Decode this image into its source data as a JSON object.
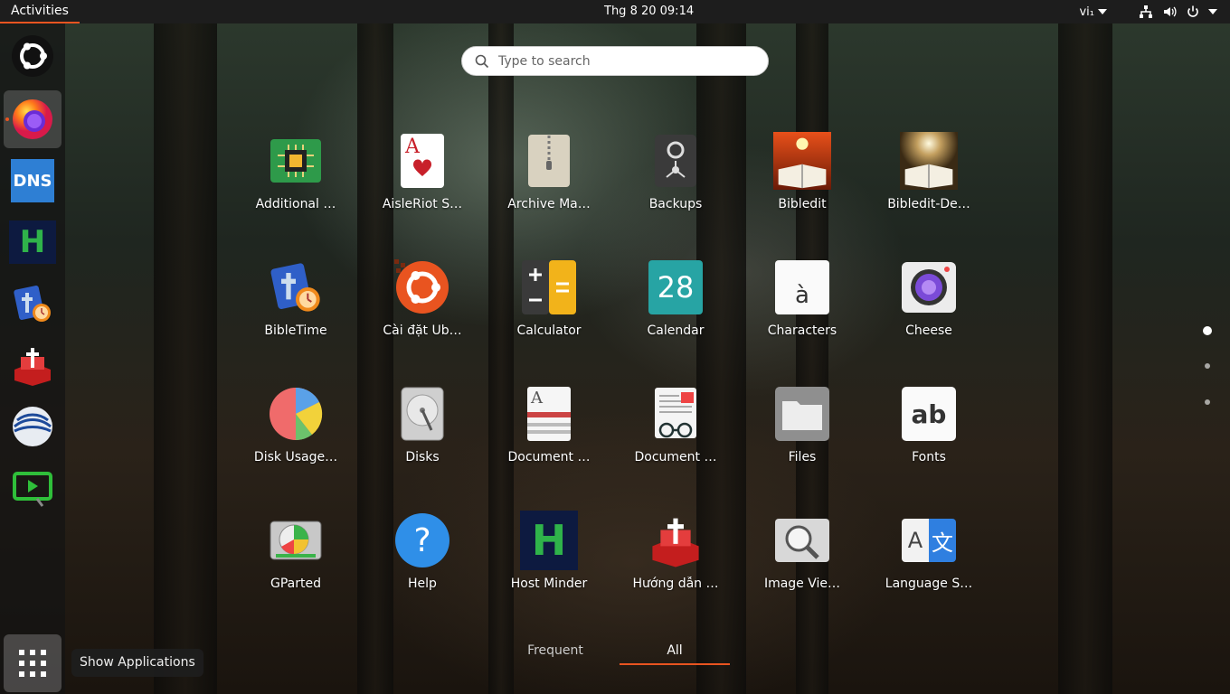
{
  "topbar": {
    "activities": "Activities",
    "clock": "Thg 8 20  09:14",
    "language": "vi₁"
  },
  "dock": {
    "items": [
      {
        "name": "ubuntu-logo-icon"
      },
      {
        "name": "firefox-icon"
      },
      {
        "name": "dns-icon",
        "text": "DNS"
      },
      {
        "name": "host-minder-icon",
        "text": "H"
      },
      {
        "name": "bibletime-icon"
      },
      {
        "name": "huong-dan-icon"
      },
      {
        "name": "unknown-globe-icon"
      },
      {
        "name": "screen-cast-icon"
      }
    ],
    "tooltip": "Show Applications"
  },
  "search": {
    "placeholder": "Type to search"
  },
  "apps": [
    {
      "label": "Additional …",
      "icon": "chip-icon"
    },
    {
      "label": "AisleRiot S…",
      "icon": "playing-card-icon",
      "text": "A"
    },
    {
      "label": "Archive Ma…",
      "icon": "archive-icon"
    },
    {
      "label": "Backups",
      "icon": "backups-icon"
    },
    {
      "label": "Bibledit",
      "icon": "bible-icon"
    },
    {
      "label": "Bibledit-De…",
      "icon": "bible-icon"
    },
    {
      "label": "BibleTime",
      "icon": "bibletime-icon"
    },
    {
      "label": "Cài đặt Ub…",
      "icon": "ubuntu-install-icon"
    },
    {
      "label": "Calculator",
      "icon": "calculator-icon"
    },
    {
      "label": "Calendar",
      "icon": "calendar-icon",
      "text": "28"
    },
    {
      "label": "Characters",
      "icon": "characters-icon",
      "text": "à"
    },
    {
      "label": "Cheese",
      "icon": "camera-icon"
    },
    {
      "label": "Disk Usage…",
      "icon": "pie-icon"
    },
    {
      "label": "Disks",
      "icon": "disk-icon"
    },
    {
      "label": "Document …",
      "icon": "document-icon",
      "text": "A"
    },
    {
      "label": "Document …",
      "icon": "document-scanner-icon"
    },
    {
      "label": "Files",
      "icon": "folder-icon"
    },
    {
      "label": "Fonts",
      "icon": "fonts-icon",
      "text": "ab"
    },
    {
      "label": "GParted",
      "icon": "gparted-icon"
    },
    {
      "label": "Help",
      "icon": "help-icon",
      "text": "?"
    },
    {
      "label": "Host Minder",
      "icon": "host-minder-icon",
      "text": "H"
    },
    {
      "label": "Hướng dẫn …",
      "icon": "huong-dan-icon"
    },
    {
      "label": "Image Vie…",
      "icon": "magnifier-icon"
    },
    {
      "label": "Language S…",
      "icon": "language-icon",
      "text": "A文"
    }
  ],
  "tabs": {
    "frequent": "Frequent",
    "all": "All"
  },
  "colors": {
    "accent": "#e95420"
  }
}
